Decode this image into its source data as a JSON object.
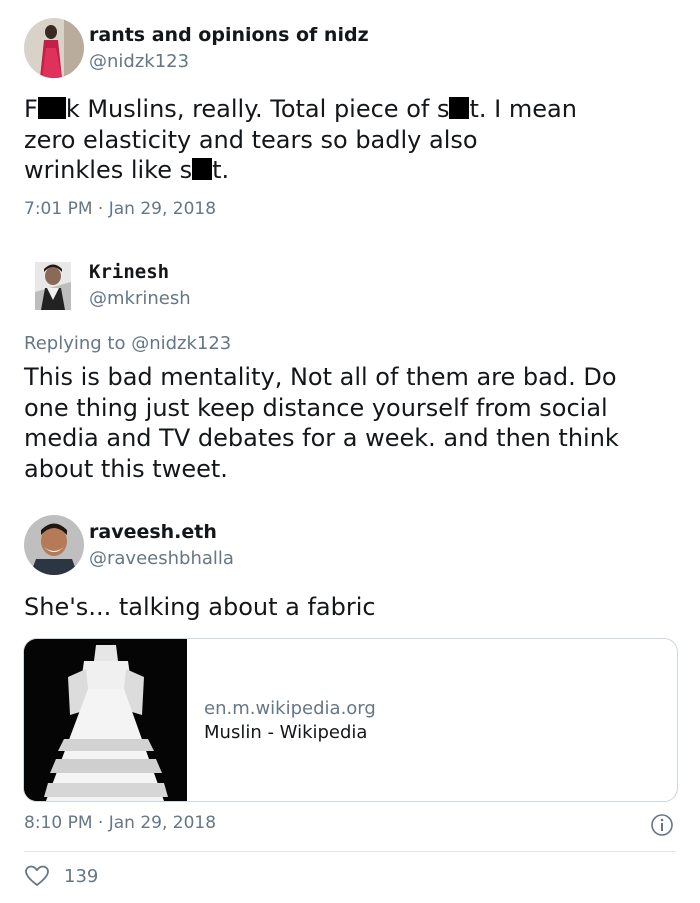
{
  "tweet1": {
    "name": "rants and opinions of nidz",
    "handle": "@nidzk123",
    "line1_a": "F",
    "line1_b": "k Muslins, really. Total piece of s",
    "line1_c": "t. I mean",
    "line2": "zero elasticity and tears so badly also",
    "line3_a": "wrinkles like s",
    "line3_b": "t.",
    "time": "7:01 PM · Jan 29, 2018"
  },
  "tweet2": {
    "name": "Krinesh",
    "handle": "@mkrinesh",
    "replying_to": "Replying to @nidzk123",
    "text": "This is bad mentality, Not all of them are bad. Do\none thing just keep distance yourself from social\nmedia and TV debates for a week. and then think\nabout this tweet."
  },
  "tweet3": {
    "name": "raveesh.eth",
    "handle": "@raveeshbhalla",
    "text": "She's... talking about a fabric",
    "card": {
      "domain": "en.m.wikipedia.org",
      "title": "Muslin - Wikipedia"
    },
    "time": "8:10 PM · Jan 29, 2018",
    "likes": "139"
  },
  "colors": {
    "text": "#14171a",
    "secondary": "#657786",
    "divider": "#e1e8ed"
  },
  "icons": {
    "info": "info-icon",
    "like": "heart-icon"
  }
}
